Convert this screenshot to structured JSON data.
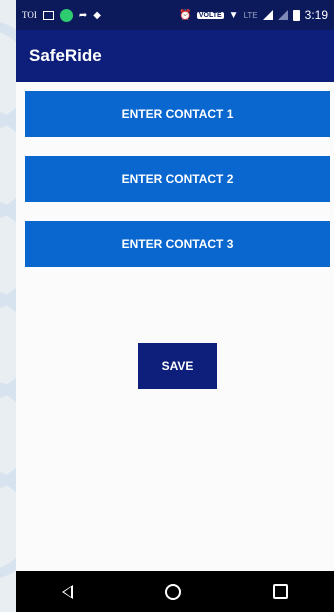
{
  "status_bar": {
    "carrier_text": "TOI",
    "volte_label": "VOLTE",
    "lte_label": "LTE",
    "time": "3:19"
  },
  "app_bar": {
    "title": "SafeRide"
  },
  "contacts": {
    "button_1_label": "ENTER CONTACT 1",
    "button_2_label": "ENTER CONTACT 2",
    "button_3_label": "ENTER CONTACT 3"
  },
  "actions": {
    "save_label": "SAVE"
  },
  "colors": {
    "status_bar": "#0c1a5c",
    "app_bar": "#0d1f7a",
    "contact_button": "#0a67cf",
    "save_button": "#0d1f7a"
  }
}
